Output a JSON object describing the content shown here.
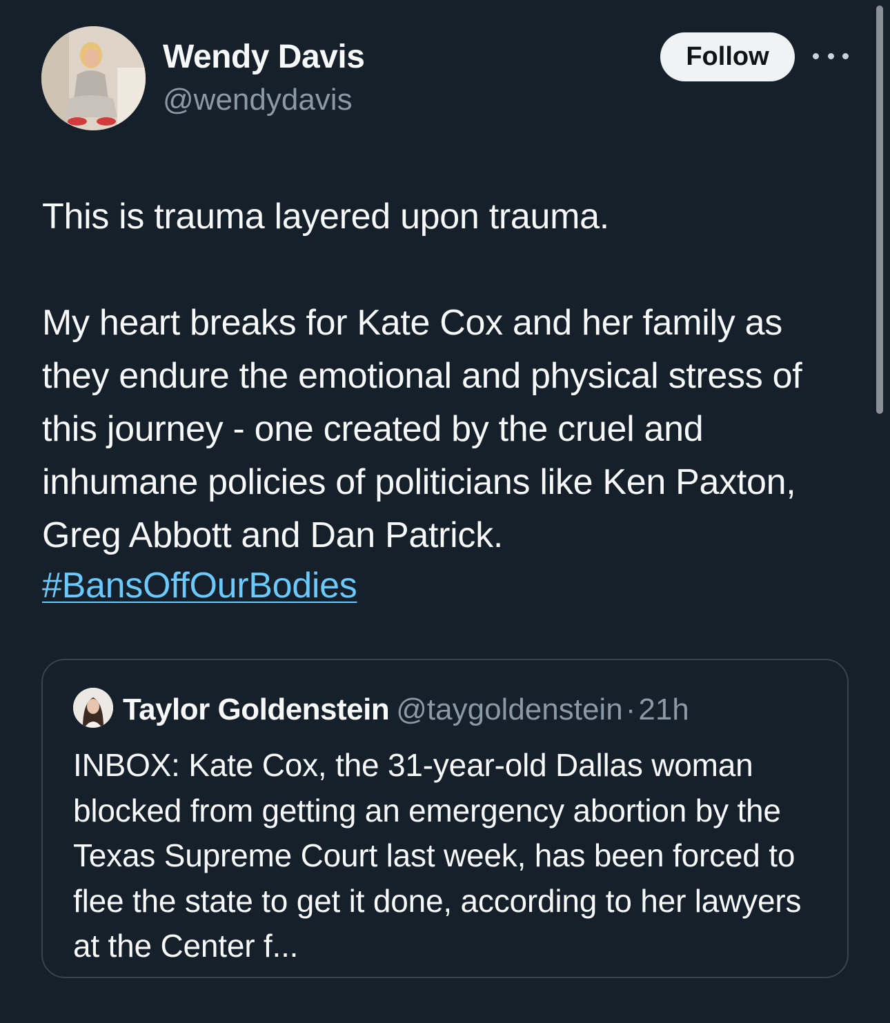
{
  "author": {
    "display_name": "Wendy Davis",
    "handle": "@wendydavis",
    "avatar_icon": "profile-photo"
  },
  "actions": {
    "follow_label": "Follow",
    "more_icon": "more-options-icon"
  },
  "tweet": {
    "text": "This is trauma layered upon trauma.\n\nMy heart breaks for Kate Cox and her family as they endure the emotional and physical stress of this journey - one created by the cruel and inhumane policies of politicians like Ken Paxton, Greg Abbott and Dan Patrick.",
    "hashtag": "#BansOffOurBodies"
  },
  "quoted_tweet": {
    "display_name": "Taylor Goldenstein",
    "handle": "@taygoldenstein",
    "separator": "·",
    "time": "21h",
    "text": "INBOX: Kate Cox, the 31-year-old Dallas woman blocked from getting an emergency abortion by the Texas Supreme Court last week, has been forced to flee the state to get it done, according to her lawyers at the Center f..."
  },
  "colors": {
    "background": "#15202b",
    "text_primary": "#f7f9f9",
    "text_secondary": "#8b98a5",
    "link": "#6bc9fb",
    "follow_button_bg": "#eff3f4",
    "border": "#38444d"
  }
}
